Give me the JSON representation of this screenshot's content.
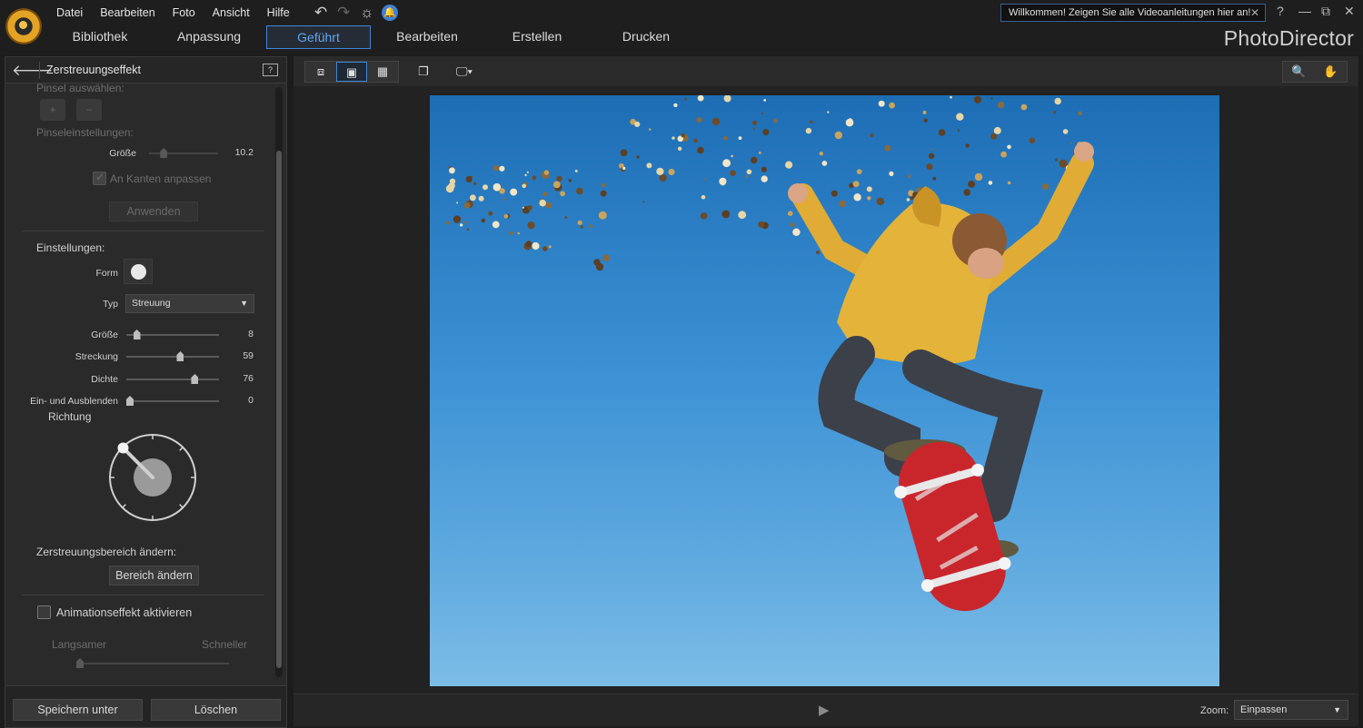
{
  "menu": [
    "Datei",
    "Bearbeiten",
    "Foto",
    "Ansicht",
    "Hilfe"
  ],
  "tabs": [
    {
      "label": "Bibliothek"
    },
    {
      "label": "Anpassung"
    },
    {
      "label": "Geführt"
    },
    {
      "label": "Bearbeiten"
    },
    {
      "label": "Erstellen"
    },
    {
      "label": "Drucken"
    }
  ],
  "active_tab": "Geführt",
  "welcome_banner": "Willkommen! Zeigen Sie alle Videoanleitungen hier an!",
  "brand": "PhotoDirector",
  "panel": {
    "title": "Zerstreuungseffekt",
    "brush_select_label": "Pinsel auswählen:",
    "brush_add": "+",
    "brush_remove": "−",
    "brush_settings_label": "Pinseleinstellungen:",
    "brush_size_label": "Größe",
    "brush_size_value": "10.2",
    "brush_size_level": 0.18,
    "edge_adapt_label": "An Kanten anpassen",
    "apply_label": "Anwenden",
    "settings_label": "Einstellungen:",
    "form_label": "Form",
    "type_label": "Typ",
    "type_value": "Streuung",
    "sliders": [
      {
        "label": "Größe",
        "value": "8",
        "level": 0.08
      },
      {
        "label": "Streckung",
        "value": "59",
        "level": 0.59
      },
      {
        "label": "Dichte",
        "value": "76",
        "level": 0.76
      },
      {
        "label": "Ein- und Ausblenden",
        "value": "0",
        "level": 0.0
      }
    ],
    "direction_label": "Richtung",
    "direction_angle_deg": 315,
    "scatter_area_label": "Zerstreuungsbereich ändern:",
    "change_area_button": "Bereich ändern",
    "animation_label": "Animationseffekt aktivieren",
    "animation_checked": false,
    "slower_label": "Langsamer",
    "faster_label": "Schneller",
    "speed_level": 0.0,
    "save_as_button": "Speichern unter",
    "delete_button": "Löschen"
  },
  "zoom": {
    "label": "Zoom:",
    "value": "Einpassen"
  },
  "colors": {
    "accent": "#3f86d6",
    "sky_top": "#1d6db4",
    "sky_bottom": "#7cbde7",
    "hoodie": "#e3b33a",
    "skateboard": "#c9262c"
  }
}
